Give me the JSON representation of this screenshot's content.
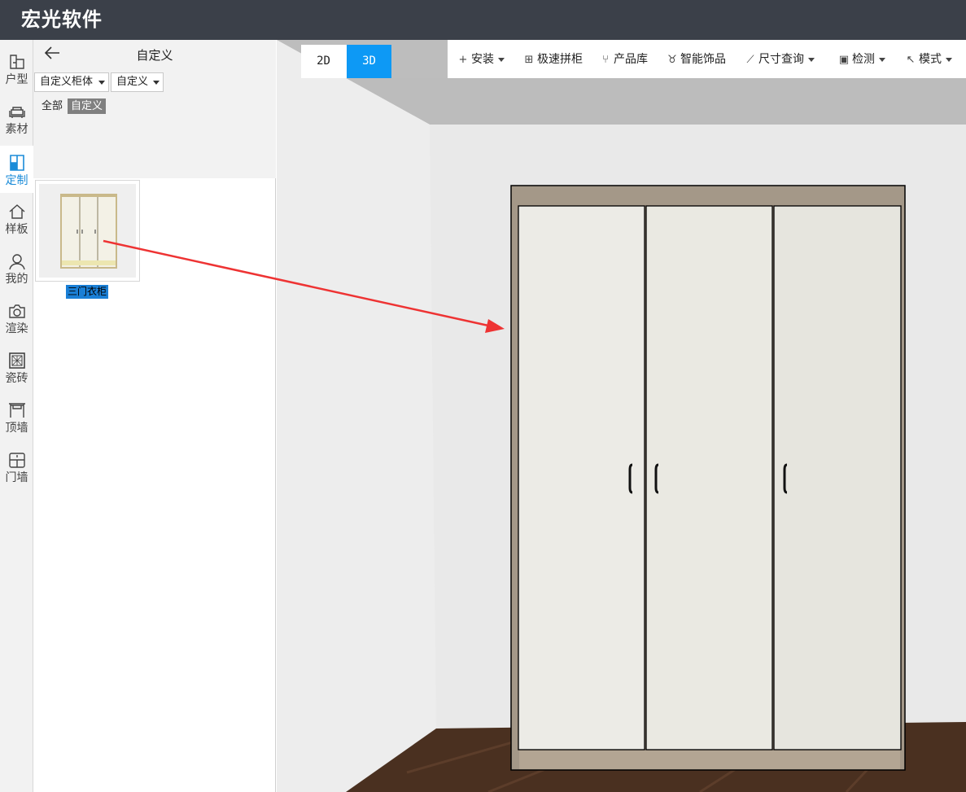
{
  "app": {
    "title": "宏光软件"
  },
  "rail": {
    "items": [
      {
        "label": "户型",
        "icon": "floorplan-icon"
      },
      {
        "label": "素材",
        "icon": "sofa-icon"
      },
      {
        "label": "定制",
        "icon": "cabinet-icon",
        "active": true
      },
      {
        "label": "样板",
        "icon": "house-icon"
      },
      {
        "label": "我的",
        "icon": "user-icon"
      },
      {
        "label": "渲染",
        "icon": "camera-icon"
      },
      {
        "label": "瓷砖",
        "icon": "tile-icon"
      },
      {
        "label": "顶墙",
        "icon": "ceiling-icon"
      },
      {
        "label": "门墙",
        "icon": "door-wall-icon"
      }
    ]
  },
  "panel": {
    "title": "自定义",
    "category_select": "自定义柜体",
    "type_select": "自定义",
    "filters": {
      "all": "全部",
      "custom": "自定义"
    },
    "product": {
      "label": "三门衣柜"
    }
  },
  "view": {
    "mode_2d": "2D",
    "mode_3d": "3D",
    "active": "3D"
  },
  "toolbar": {
    "install": "安装",
    "quick_cabinet": "极速拼柜",
    "product_library": "产品库",
    "smart_decor": "智能饰品",
    "dimension_query": "尺寸查询",
    "inspect": "检测",
    "mode": "模式"
  },
  "colors": {
    "titlebar": "#3b4049",
    "accent": "#0d99f5",
    "annotation_arrow": "#ee3333"
  }
}
